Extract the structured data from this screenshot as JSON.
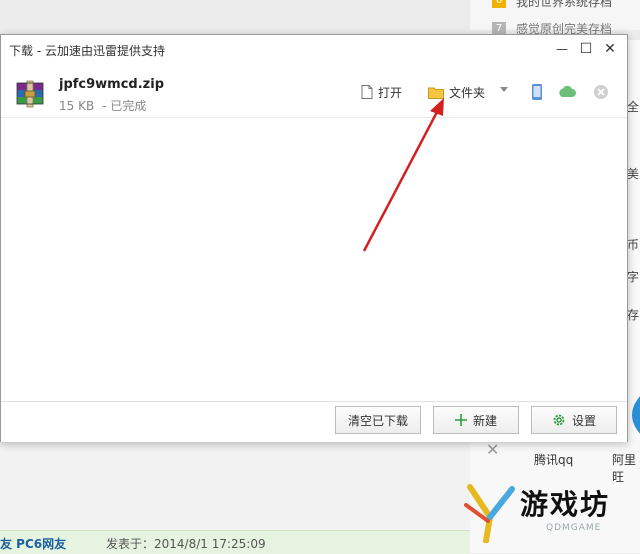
{
  "background": {
    "top_items": [
      {
        "badge": "6",
        "text": "我的世界系统存档"
      },
      {
        "badge": "7",
        "text": "感觉原创完美存档"
      }
    ],
    "right_fragments": [
      "全",
      "完美",
      "文币",
      "档字",
      "ki存"
    ],
    "lower_links": [
      "腾讯qq",
      "阿里旺"
    ],
    "post": {
      "user": "友 PC6网友",
      "posted": "发表于：2014/8/1 17:25:09"
    },
    "watermark": {
      "text": "游戏坊",
      "sub": "QDMGAME"
    }
  },
  "dialog": {
    "title": "下载 - 云加速由迅雷提供支持",
    "controls": {
      "minimize": "—",
      "maximize": "☐",
      "close": "✕"
    },
    "download": {
      "file_name": "jpfc9wmcd.zip",
      "size": "15 KB",
      "status": "- 已完成",
      "actions": {
        "open": "打开",
        "folder": "文件夹"
      }
    },
    "footer": {
      "clear_label": "清空已下载",
      "new_label": "新建",
      "settings_label": "设置"
    }
  },
  "colors": {
    "accent_green": "#2a9a3a",
    "arrow_red": "#d42020",
    "folder_yellow": "#f5c542",
    "cloud_green": "#6cc07a"
  }
}
